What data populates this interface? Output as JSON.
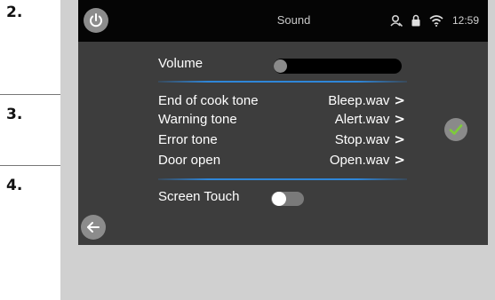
{
  "document": {
    "steps": [
      "2.",
      "3.",
      "4."
    ]
  },
  "screen": {
    "title": "Sound",
    "status": {
      "time": "12:59",
      "icons": [
        "person-icon",
        "lock-icon",
        "wifi-icon"
      ]
    },
    "volume": {
      "label": "Volume",
      "level": 0
    },
    "sounds": [
      {
        "label": "End of cook tone",
        "value": "Bleep.wav"
      },
      {
        "label": "Warning tone",
        "value": "Alert.wav"
      },
      {
        "label": "Error tone",
        "value": "Stop.wav"
      },
      {
        "label": "Door open",
        "value": "Open.wav"
      }
    ],
    "chevron": ">",
    "screen_touch": {
      "label": "Screen Touch",
      "enabled": false
    },
    "colors": {
      "accent": "#2f86d8",
      "confirm": "#7ecb3a",
      "screen_bg": "#3d3d3d",
      "statusbar_bg": "#050505"
    }
  }
}
